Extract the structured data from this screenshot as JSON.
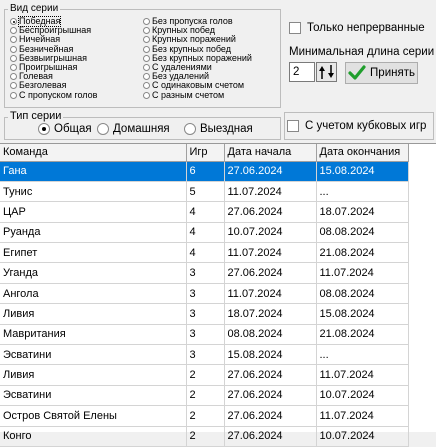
{
  "series_type_box": {
    "legend": "Вид серии",
    "col1": [
      "Победная",
      "Беспроигрышная",
      "Ничейная",
      "Безничейная",
      "Безвыигрышная",
      "Проигрышная",
      "Голевая",
      "Безголевая",
      "С пропуском голов"
    ],
    "col2": [
      "Без пропуска голов",
      "Крупных побед",
      "Крупных поражений",
      "Без крупных побед",
      "Без крупных поражений",
      "С удалениями",
      "Без удалений",
      "С одинаковым счетом",
      "С разным счетом"
    ],
    "selected": "Победная"
  },
  "options": {
    "only_continuous": "Только непрерванные",
    "min_length_label": "Минимальная длина серии",
    "min_length_value": "2",
    "apply_button": "Принять",
    "with_cup_games": "С учетом кубковых игр"
  },
  "series_kind_box": {
    "legend": "Тип серии",
    "options": [
      "Общая",
      "Домашняя",
      "Выездная"
    ],
    "selected": "Общая"
  },
  "table": {
    "headers": [
      "Команда",
      "Игр",
      "Дата начала",
      "Дата окончания"
    ],
    "rows": [
      [
        "Гана",
        "6",
        "27.06.2024",
        "15.08.2024"
      ],
      [
        "Тунис",
        "5",
        "11.07.2024",
        "..."
      ],
      [
        "ЦАР",
        "4",
        "27.06.2024",
        "18.07.2024"
      ],
      [
        "Руанда",
        "4",
        "10.07.2024",
        "08.08.2024"
      ],
      [
        "Египет",
        "4",
        "11.07.2024",
        "21.08.2024"
      ],
      [
        "Уганда",
        "3",
        "27.06.2024",
        "11.07.2024"
      ],
      [
        "Ангола",
        "3",
        "11.07.2024",
        "08.08.2024"
      ],
      [
        "Ливия",
        "3",
        "18.07.2024",
        "15.08.2024"
      ],
      [
        "Мавритания",
        "3",
        "08.08.2024",
        "21.08.2024"
      ],
      [
        "Эсватини",
        "3",
        "15.08.2024",
        "..."
      ],
      [
        "Ливия",
        "2",
        "27.06.2024",
        "11.07.2024"
      ],
      [
        "Эсватини",
        "2",
        "27.06.2024",
        "10.07.2024"
      ],
      [
        "Остров Святой Елены",
        "2",
        "27.06.2024",
        "11.07.2024"
      ],
      [
        "Конго",
        "2",
        "27.06.2024",
        "10.07.2024"
      ]
    ],
    "selected_row": 0
  }
}
